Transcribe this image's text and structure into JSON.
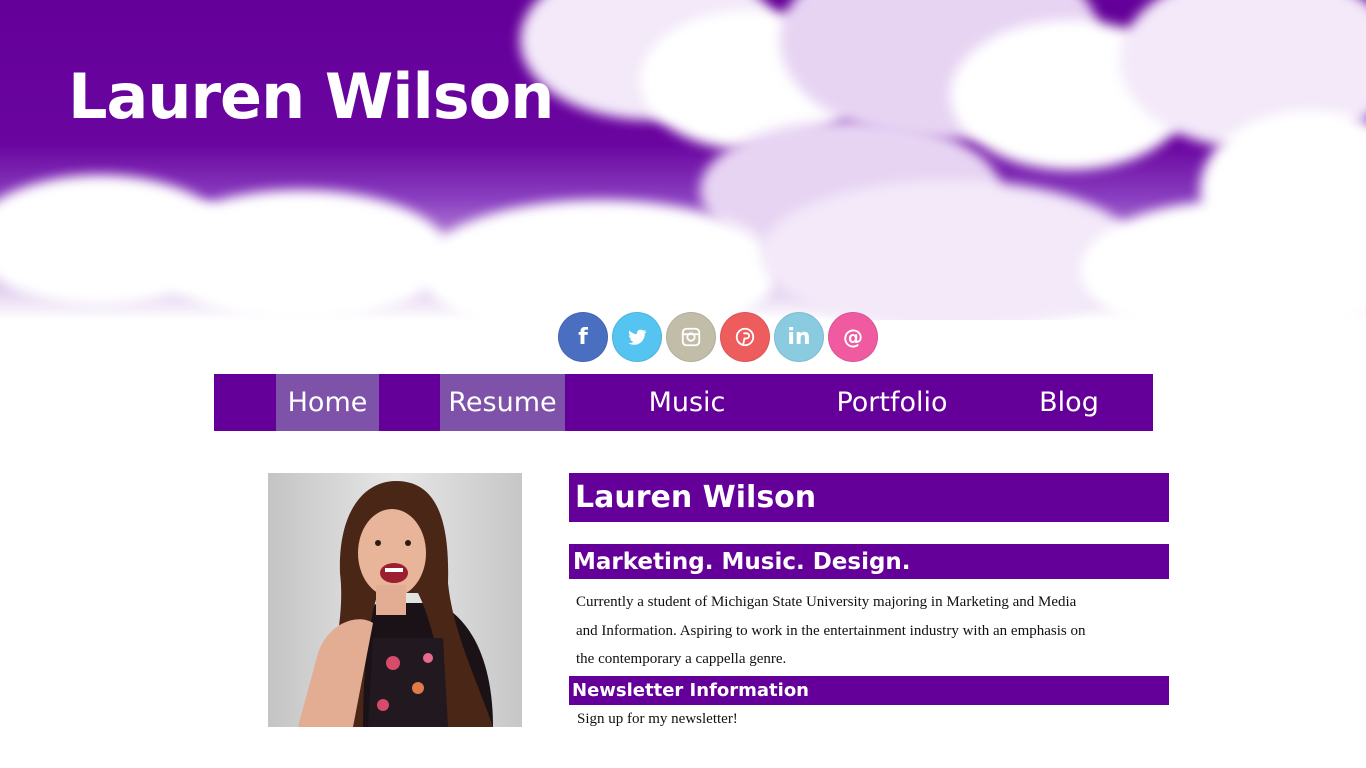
{
  "header": {
    "title": "Lauren Wilson"
  },
  "social": [
    {
      "id": "facebook",
      "glyph": "f",
      "icon": "facebook-icon",
      "color": "#4a6fc0"
    },
    {
      "id": "twitter",
      "glyph": "",
      "icon": "twitter-icon",
      "color": "#55c4f0"
    },
    {
      "id": "instagram",
      "glyph": "",
      "icon": "instagram-icon",
      "color": "#c2bda9"
    },
    {
      "id": "pinterest",
      "glyph": "",
      "icon": "pinterest-icon",
      "color": "#ee5d5d"
    },
    {
      "id": "linkedin",
      "glyph": "in",
      "icon": "linkedin-icon",
      "color": "#8acbe0"
    },
    {
      "id": "email",
      "glyph": "@",
      "icon": "email-icon",
      "color": "#ef5aa0"
    }
  ],
  "nav": {
    "items": [
      {
        "label": "Home",
        "active": true
      },
      {
        "label": "Resume",
        "active": true
      },
      {
        "label": "Music",
        "active": false
      },
      {
        "label": "Portfolio",
        "active": false
      },
      {
        "label": "Blog",
        "active": false
      }
    ]
  },
  "main": {
    "name_heading": "Lauren Wilson",
    "tagline": "Marketing. Music. Design.",
    "about_lines": [
      "Currently a student of Michigan State University majoring in Marketing and Media",
      "and Information. Aspiring to work in the entertainment industry with an emphasis on",
      "the contemporary a cappella genre."
    ],
    "newsletter_heading": "Newsletter Information",
    "newsletter_text": "Sign up for my newsletter!"
  },
  "colors": {
    "brand_purple": "#640099",
    "nav_active": "#7d52a8"
  }
}
